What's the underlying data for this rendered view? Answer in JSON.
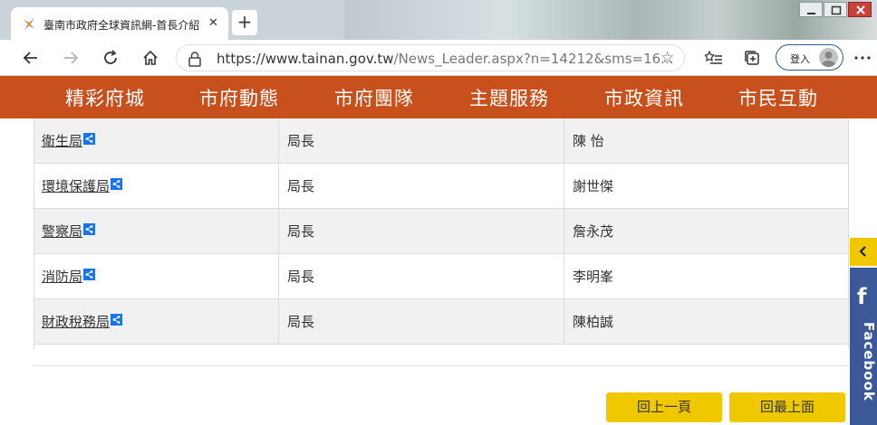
{
  "browser": {
    "tab_title": "臺南市政府全球資訊網-首長介紹",
    "tab_close": "✕",
    "new_tab": "+",
    "url_host": "https://www.tainan.gov.tw",
    "url_path": "/News_Leader.aspx?n=14212&sms=16...",
    "signin_label": "登入"
  },
  "menu": {
    "items": [
      "精彩府城",
      "市府動態",
      "市府團隊",
      "主題服務",
      "市政資訊",
      "市民互動"
    ]
  },
  "table": {
    "rows": [
      {
        "department": "衛生局",
        "title": "局長",
        "name": "陳 怡"
      },
      {
        "department": "環境保護局",
        "title": "局長",
        "name": "謝世傑"
      },
      {
        "department": "警察局",
        "title": "局長",
        "name": "詹永茂"
      },
      {
        "department": "消防局",
        "title": "局長",
        "name": "李明峯"
      },
      {
        "department": "財政稅務局",
        "title": "局長",
        "name": "陳柏誠"
      }
    ]
  },
  "buttons": {
    "back": "回上一頁",
    "top": "回最上面"
  },
  "side": {
    "facebook_label": "Facebook",
    "facebook_letter": "f"
  },
  "colors": {
    "menu_bg": "#c8501c",
    "button_bg": "#f0c800",
    "facebook_bg": "#3b5998"
  }
}
